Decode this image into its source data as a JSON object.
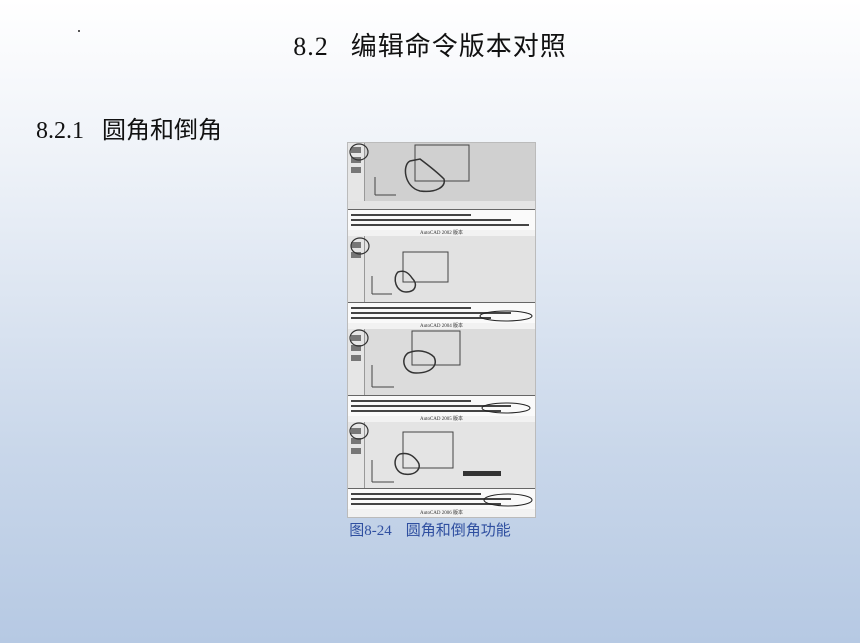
{
  "slide": {
    "title_number": "8.2",
    "title_text": "编辑命令版本对照",
    "section_number": "8.2.1",
    "section_text": "圆角和倒角"
  },
  "figure": {
    "panels": [
      {
        "caption": "AutoCAD 2002 版本"
      },
      {
        "caption": "AutoCAD 2004 版本"
      },
      {
        "caption": "AutoCAD 2005 版本"
      },
      {
        "caption": "AutoCAD 2006 版本"
      }
    ],
    "caption_number": "图8-24",
    "caption_text": "圆角和倒角功能"
  }
}
